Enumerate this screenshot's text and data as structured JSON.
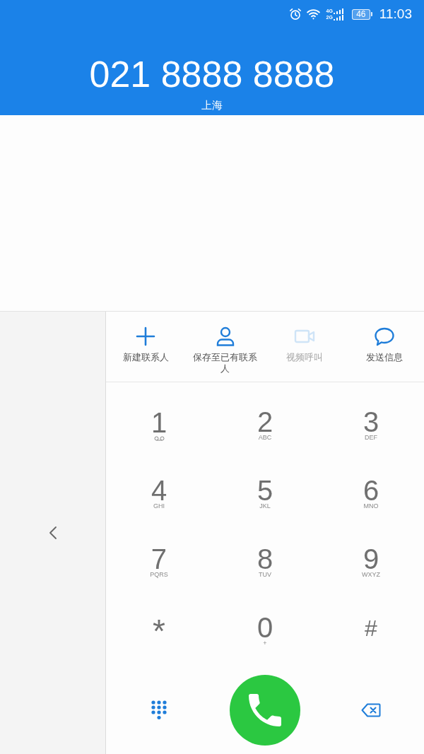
{
  "status_bar": {
    "networks": [
      {
        "label": "4G"
      },
      {
        "label": "2G"
      }
    ],
    "battery": "46",
    "time": "11:03"
  },
  "header": {
    "number": "021 8888 8888",
    "location": "上海"
  },
  "actions": [
    {
      "kind": "add",
      "label": "新建联系人",
      "disabled": false
    },
    {
      "kind": "person",
      "label": "保存至已有联系人",
      "disabled": false
    },
    {
      "kind": "video",
      "label": "视频呼叫",
      "disabled": true
    },
    {
      "kind": "message",
      "label": "发送信息",
      "disabled": false
    }
  ],
  "keypad": [
    {
      "digit": "1",
      "kind": "voicemail"
    },
    {
      "digit": "2",
      "letters": "ABC",
      "kind": "letters"
    },
    {
      "digit": "3",
      "letters": "DEF",
      "kind": "letters"
    },
    {
      "digit": "4",
      "letters": "GHI",
      "kind": "letters"
    },
    {
      "digit": "5",
      "letters": "JKL",
      "kind": "letters"
    },
    {
      "digit": "6",
      "letters": "MNO",
      "kind": "letters"
    },
    {
      "digit": "7",
      "letters": "PQRS",
      "kind": "letters"
    },
    {
      "digit": "8",
      "letters": "TUV",
      "kind": "letters"
    },
    {
      "digit": "9",
      "letters": "WXYZ",
      "kind": "letters"
    },
    {
      "digit": "*",
      "kind": "symbol"
    },
    {
      "digit": "0",
      "letters": "+",
      "kind": "letters"
    },
    {
      "digit": "#",
      "kind": "plain"
    }
  ]
}
